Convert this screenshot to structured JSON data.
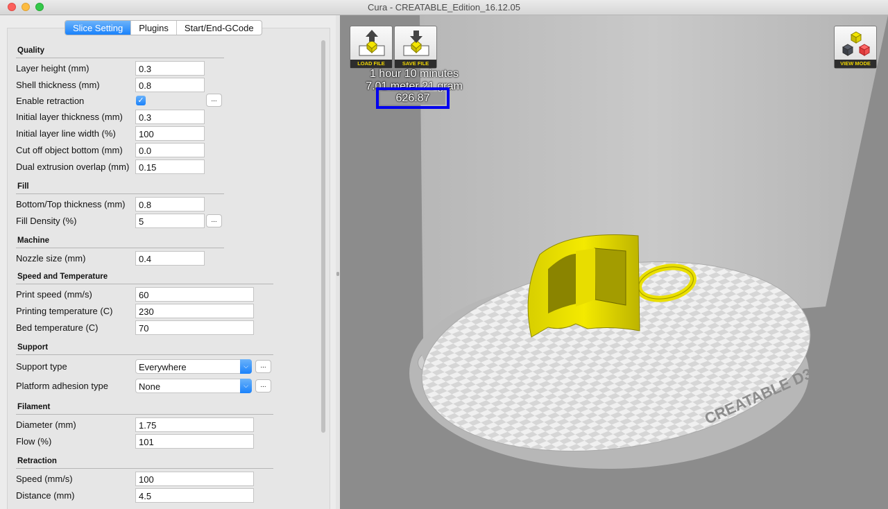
{
  "window": {
    "title": "Cura - CREATABLE_Edition_16.12.05"
  },
  "tabs": [
    "Slice Setting",
    "Plugins",
    "Start/End-GCode"
  ],
  "sections": {
    "quality": "Quality",
    "fill": "Fill",
    "machine": "Machine",
    "speed": "Speed and Temperature",
    "support": "Support",
    "filament": "Filament",
    "retraction": "Retraction"
  },
  "settings": {
    "layer_height": {
      "label": "Layer height (mm)",
      "value": "0.3"
    },
    "shell_thickness": {
      "label": "Shell thickness (mm)",
      "value": "0.8"
    },
    "enable_retraction": {
      "label": "Enable retraction",
      "checked": true
    },
    "initial_layer_thickness": {
      "label": "Initial layer thickness (mm)",
      "value": "0.3"
    },
    "initial_layer_line_width": {
      "label": "Initial layer line width (%)",
      "value": "100"
    },
    "cut_off_object_bottom": {
      "label": "Cut off object bottom (mm)",
      "value": "0.0"
    },
    "dual_extrusion_overlap": {
      "label": "Dual extrusion overlap (mm)",
      "value": "0.15"
    },
    "bottom_top_thickness": {
      "label": "Bottom/Top thickness (mm)",
      "value": "0.8"
    },
    "fill_density": {
      "label": "Fill Density (%)",
      "value": "5"
    },
    "nozzle_size": {
      "label": "Nozzle size (mm)",
      "value": "0.4"
    },
    "print_speed": {
      "label": "Print speed (mm/s)",
      "value": "60"
    },
    "printing_temperature": {
      "label": "Printing temperature (C)",
      "value": "230"
    },
    "bed_temperature": {
      "label": "Bed temperature (C)",
      "value": "70"
    },
    "support_type": {
      "label": "Support type",
      "value": "Everywhere"
    },
    "platform_adhesion_type": {
      "label": "Platform adhesion type",
      "value": "None"
    },
    "diameter": {
      "label": "Diameter (mm)",
      "value": "1.75"
    },
    "flow": {
      "label": "Flow (%)",
      "value": "101"
    },
    "retraction_speed": {
      "label": "Speed (mm/s)",
      "value": "100"
    },
    "retraction_distance": {
      "label": "Distance (mm)",
      "value": "4.5"
    }
  },
  "dots_label": "...",
  "viewport": {
    "load_file": "LOAD FILE",
    "save_file": "SAVE FILE",
    "view_mode": "VIEW MODE",
    "print_time": "1 hour 10 minutes",
    "material": "7.01 meter 21 gram",
    "cost": "626.87",
    "bed_label": "CREATABLE D3"
  },
  "colors": {
    "accent": "#1a82fb",
    "model": "#f2e600",
    "highlight": "#0000ee"
  }
}
